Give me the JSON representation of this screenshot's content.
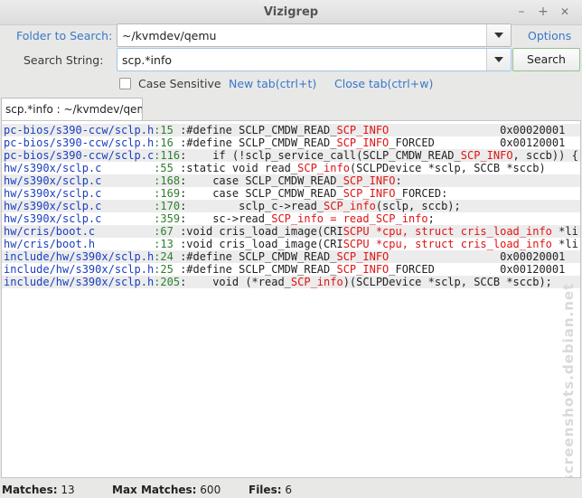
{
  "window": {
    "title": "Vizigrep",
    "minimize": "–",
    "maximize": "+",
    "close": "✕"
  },
  "form": {
    "folder_label": "Folder to Search:",
    "folder_value": "~/kvmdev/qemu",
    "options_label": "Options",
    "search_label": "Search String:",
    "search_value": "scp.*info",
    "search_button": "Search",
    "case_label": "Case Sensitive",
    "new_tab": "New tab(ctrl+t)",
    "close_tab": "Close tab(ctrl+w)"
  },
  "tab": {
    "label": "scp.*info : ~/kvmdev/qemu"
  },
  "results": [
    {
      "file": "pc-bios/s390-ccw/sclp.h",
      "line": ":15",
      "pre": " :#define SCLP_CMDW_READ_",
      "match": "SCP_INFO",
      "post": "                 0x00020001"
    },
    {
      "file": "pc-bios/s390-ccw/sclp.h",
      "line": ":16",
      "pre": " :#define SCLP_CMDW_READ_",
      "match": "SCP_INFO",
      "post": "_FORCED          0x00120001"
    },
    {
      "file": "pc-bios/s390-ccw/sclp.c",
      "line": ":116",
      "pre": ":    if (!sclp_service_call(SCLP_CMDW_READ_",
      "match": "SCP_INFO",
      "post": ", sccb)) {"
    },
    {
      "file": "hw/s390x/sclp.c        ",
      "line": ":55",
      "pre": " :static void read_",
      "match": "SCP_info",
      "post": "(SCLPDevice *sclp, SCCB *sccb)"
    },
    {
      "file": "hw/s390x/sclp.c        ",
      "line": ":168",
      "pre": ":    case SCLP_CMDW_READ_",
      "match": "SCP_INFO",
      "post": ":"
    },
    {
      "file": "hw/s390x/sclp.c        ",
      "line": ":169",
      "pre": ":    case SCLP_CMDW_READ_",
      "match": "SCP_INFO",
      "post": "_FORCED:"
    },
    {
      "file": "hw/s390x/sclp.c        ",
      "line": ":170",
      "pre": ":        sclp_c->read_",
      "match": "SCP_info",
      "post": "(sclp, sccb);"
    },
    {
      "file": "hw/s390x/sclp.c        ",
      "line": ":359",
      "pre": ":    sc->read_",
      "match": "SCP_info = read_SCP_info",
      "post": ";"
    },
    {
      "file": "hw/cris/boot.c         ",
      "line": ":67",
      "pre": " :void cris_load_image(CRI",
      "match": "SCPU *cpu, struct cris_load_info",
      "post": " *li)"
    },
    {
      "file": "hw/cris/boot.h         ",
      "line": ":13",
      "pre": " :void cris_load_image(CRI",
      "match": "SCPU *cpu, struct cris_load_info",
      "post": " *li);"
    },
    {
      "file": "include/hw/s390x/sclp.h",
      "line": ":24",
      "pre": " :#define SCLP_CMDW_READ_",
      "match": "SCP_INFO",
      "post": "                 0x00020001"
    },
    {
      "file": "include/hw/s390x/sclp.h",
      "line": ":25",
      "pre": " :#define SCLP_CMDW_READ_",
      "match": "SCP_INFO",
      "post": "_FORCED          0x00120001"
    },
    {
      "file": "include/hw/s390x/sclp.h",
      "line": ":205",
      "pre": ":    void (*read_",
      "match": "SCP_info",
      "post": ")(SCLPDevice *sclp, SCCB *sccb);"
    }
  ],
  "status": {
    "matches_label": "Matches:",
    "matches_value": "13",
    "max_label": "Max Matches:",
    "max_value": "600",
    "files_label": "Files:",
    "files_value": "6"
  },
  "watermark": "screenshots.debian.net",
  "colors": {
    "file": "#1a3fbf",
    "line": "#2f7f2f",
    "match": "#e01414",
    "link": "#3a78c8"
  }
}
